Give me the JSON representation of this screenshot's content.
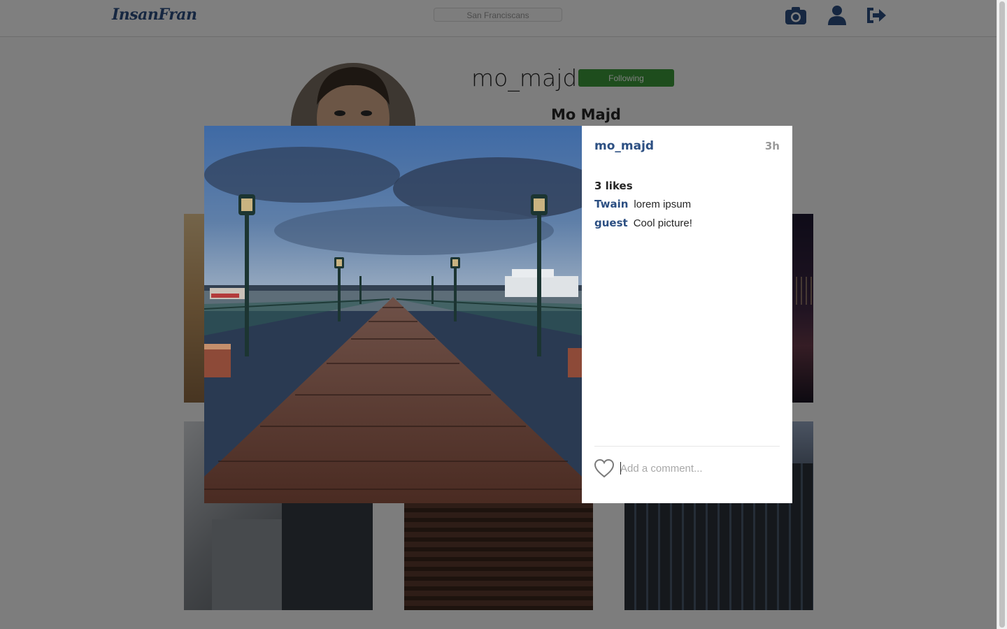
{
  "header": {
    "logo": "InsanFran",
    "search_value": "San Franciscans",
    "icons": [
      "camera-icon",
      "user-icon",
      "logout-icon"
    ]
  },
  "profile": {
    "username": "mo_majd",
    "follow_label": "Following",
    "full_name": "Mo Majd"
  },
  "modal": {
    "author": "mo_majd",
    "time_ago": "3h",
    "likes": "3 likes",
    "comments": [
      {
        "author": "Twain",
        "text": "lorem ipsum"
      },
      {
        "author": "guest",
        "text": "Cool picture!"
      }
    ],
    "comment_placeholder": "Add a comment..."
  },
  "colors": {
    "brand": "#2c4f82",
    "following": "#3c9b3a",
    "overlay": "rgba(0,0,0,0.5)"
  }
}
